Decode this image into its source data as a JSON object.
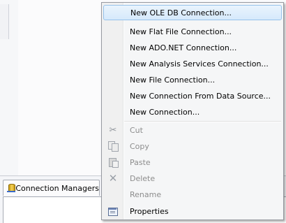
{
  "context_menu": {
    "items": [
      {
        "label": "New OLE DB Connection...",
        "icon": null,
        "enabled": true,
        "highlighted": true
      },
      {
        "label": "New Flat File Connection...",
        "icon": null,
        "enabled": true
      },
      {
        "label": "New ADO.NET Connection...",
        "icon": null,
        "enabled": true
      },
      {
        "label": "New Analysis Services Connection...",
        "icon": null,
        "enabled": true
      },
      {
        "label": "New File Connection...",
        "icon": null,
        "enabled": true
      },
      {
        "label": "New Connection From Data Source...",
        "icon": null,
        "enabled": true
      },
      {
        "label": "New Connection...",
        "icon": null,
        "enabled": true
      },
      {
        "label": "Cut",
        "icon": "scissors-icon",
        "enabled": false
      },
      {
        "label": "Copy",
        "icon": "copy-icon",
        "enabled": false
      },
      {
        "label": "Paste",
        "icon": "paste-icon",
        "enabled": false
      },
      {
        "label": "Delete",
        "icon": "delete-icon",
        "enabled": false
      },
      {
        "label": "Rename",
        "icon": null,
        "enabled": false
      },
      {
        "label": "Properties",
        "icon": "properties-icon",
        "enabled": true
      }
    ]
  },
  "tabs": {
    "connection_managers": {
      "label": "Connection Managers",
      "icon": "connection-manager-icon"
    }
  },
  "colors": {
    "highlight_border": "#96c2ea",
    "disabled_text": "#8d8d8d",
    "menu_background": "#f5f6f7"
  }
}
